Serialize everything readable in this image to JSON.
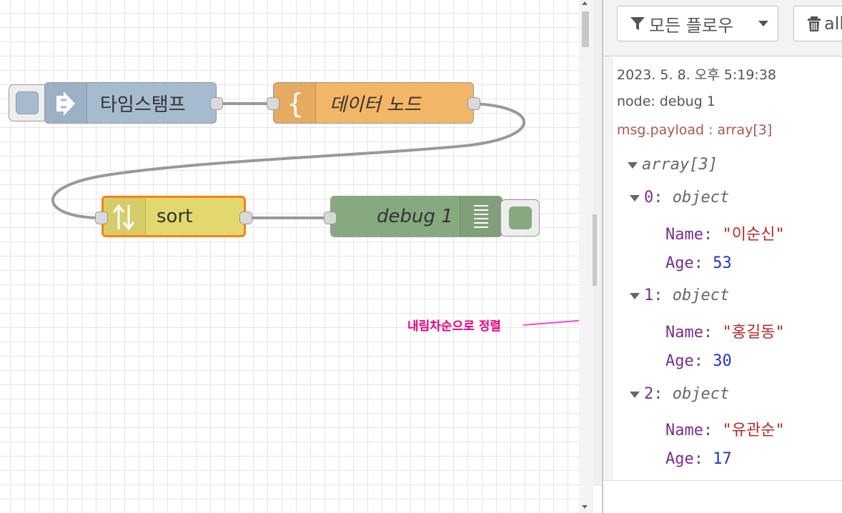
{
  "flow": {
    "nodes": {
      "inject": {
        "label": "타임스탬프",
        "color": "#a6bbcf",
        "icon": "arrow-right-icon"
      },
      "change": {
        "label": "데이터 노드",
        "color": "#f3b567",
        "icon": "curly-brace-icon"
      },
      "sort": {
        "label": "sort",
        "color": "#e2d96e",
        "icon": "sort-arrows-icon",
        "selected_color": "#ff7f0e"
      },
      "debug": {
        "label": "debug 1",
        "color": "#87a980",
        "icon": "list-icon"
      }
    },
    "annotation": "내림차순으로 정렬",
    "annotation_color": "#e6007e"
  },
  "sidebar": {
    "filter_label": "모든 플로우",
    "clear_label": "all",
    "message": {
      "timestamp": "2023. 5. 8. 오후 5:19:38",
      "node": "node: debug 1",
      "topic": "msg.payload : array[3]",
      "root_type": "array[3]",
      "items": [
        {
          "index": "0",
          "type": "object",
          "name_key": "Name",
          "name": "\"이순신\"",
          "age_key": "Age",
          "age": "53"
        },
        {
          "index": "1",
          "type": "object",
          "name_key": "Name",
          "name": "\"홍길동\"",
          "age_key": "Age",
          "age": "30"
        },
        {
          "index": "2",
          "type": "object",
          "name_key": "Name",
          "name": "\"유관순\"",
          "age_key": "Age",
          "age": "17"
        }
      ]
    }
  }
}
